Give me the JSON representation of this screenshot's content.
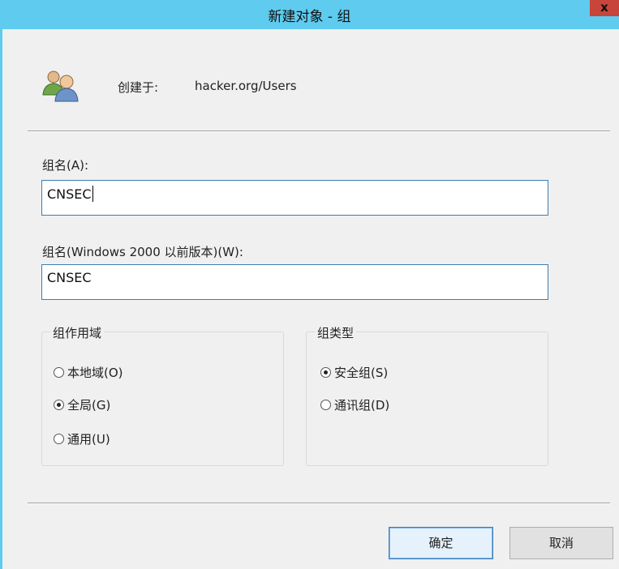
{
  "window": {
    "title": "新建对象 - 组",
    "close_glyph": "x"
  },
  "header": {
    "created_in_label": "创建于:",
    "path": "hacker.org/Users",
    "icon": "group-users-icon"
  },
  "group_name": {
    "label": "组名(A):",
    "value": "CNSEC"
  },
  "group_name_pre2000": {
    "label": "组名(Windows 2000 以前版本)(W):",
    "value": "CNSEC"
  },
  "scope": {
    "legend": "组作用域",
    "options": [
      {
        "label": "本地域(O)",
        "selected": false
      },
      {
        "label": "全局(G)",
        "selected": true
      },
      {
        "label": "通用(U)",
        "selected": false
      }
    ]
  },
  "type": {
    "legend": "组类型",
    "options": [
      {
        "label": "安全组(S)",
        "selected": true
      },
      {
        "label": "通讯组(D)",
        "selected": false
      }
    ]
  },
  "buttons": {
    "ok": "确定",
    "cancel": "取消"
  },
  "colors": {
    "titlebar": "#5ecbef",
    "close": "#c7453a",
    "focus_border": "#3c7fb1"
  }
}
